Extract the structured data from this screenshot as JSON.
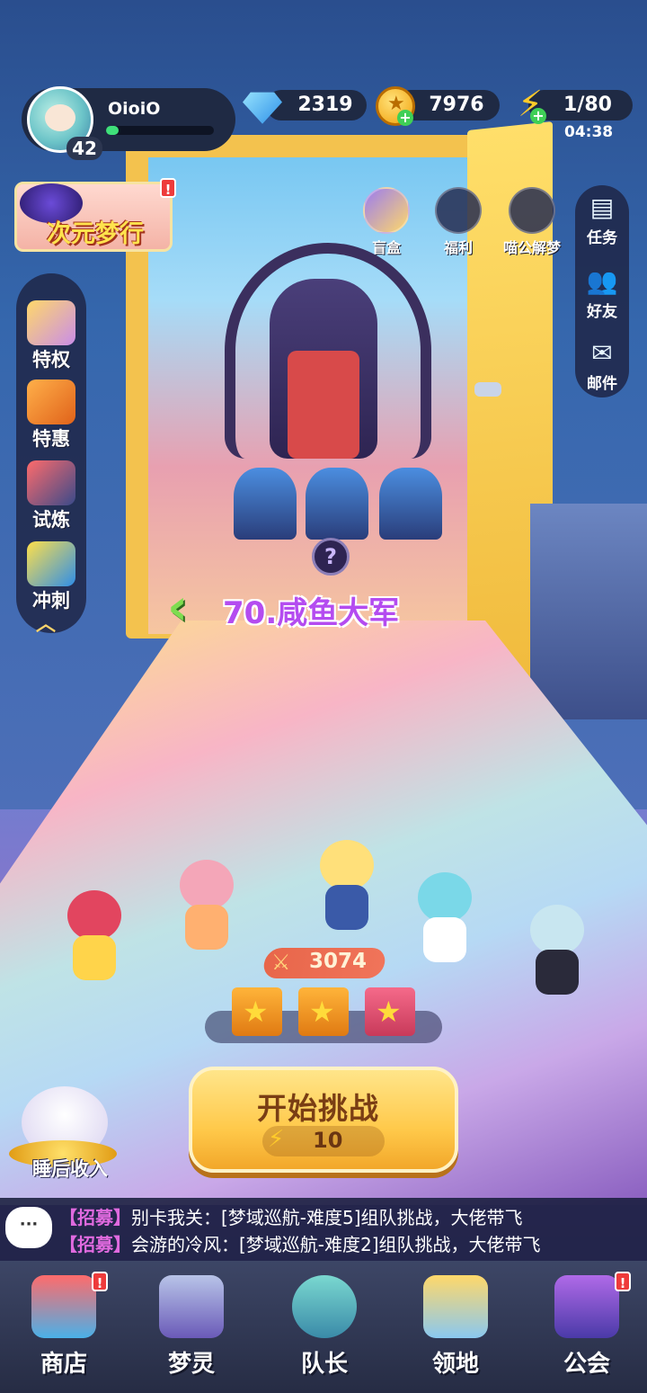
{
  "player": {
    "name": "OioiO",
    "level": "42",
    "exp_fraction": 0.12
  },
  "resources": {
    "gems": "2319",
    "coins": "7976",
    "energy": "1/80",
    "energy_timer": "04:38"
  },
  "event": {
    "title": "次元梦行",
    "badge": "!"
  },
  "left_menu": [
    {
      "label": "特权",
      "icon": "privilege-tickets-icon"
    },
    {
      "label": "特惠",
      "icon": "discount-box-icon"
    },
    {
      "label": "试炼",
      "icon": "trial-rocket-icon"
    },
    {
      "label": "冲刺",
      "icon": "sprint-trophy-icon"
    }
  ],
  "top_icons": [
    {
      "label": "盲盒",
      "icon": "blind-box-icon"
    },
    {
      "label": "福利",
      "icon": "gift-icon"
    },
    {
      "label": "喵公解梦",
      "icon": "cat-dream-icon"
    }
  ],
  "right_menu": [
    {
      "label": "任务",
      "icon": "task-clipboard-icon"
    },
    {
      "label": "好友",
      "icon": "friends-icon"
    },
    {
      "label": "邮件",
      "icon": "mail-icon"
    }
  ],
  "stage": {
    "title": "70.咸鱼大军",
    "badge": "?"
  },
  "team": {
    "power": "3074"
  },
  "start": {
    "label": "开始挑战",
    "cost": "10"
  },
  "sleep": {
    "label": "睡后收入"
  },
  "chat": [
    {
      "tag": "【招募】",
      "text": "别卡我关：[梦域巡航-难度5]组队挑战，大佬带飞"
    },
    {
      "tag": "【招募】",
      "text": "会游的冷风：[梦域巡航-难度2]组队挑战，大佬带飞"
    }
  ],
  "chat_icon": "···",
  "nav": [
    {
      "label": "商店",
      "icon": "shop-icon",
      "badge": "!"
    },
    {
      "label": "梦灵",
      "icon": "dream-spirit-icon"
    },
    {
      "label": "队长",
      "icon": "captain-icon"
    },
    {
      "label": "领地",
      "icon": "territory-icon"
    },
    {
      "label": "公会",
      "icon": "guild-icon",
      "badge": "!"
    }
  ],
  "colors": {
    "panel": "#1f2a44",
    "accent_gold": "#ffc94a",
    "stage_title": "#b44cf0",
    "exp": "#3fe07a"
  }
}
